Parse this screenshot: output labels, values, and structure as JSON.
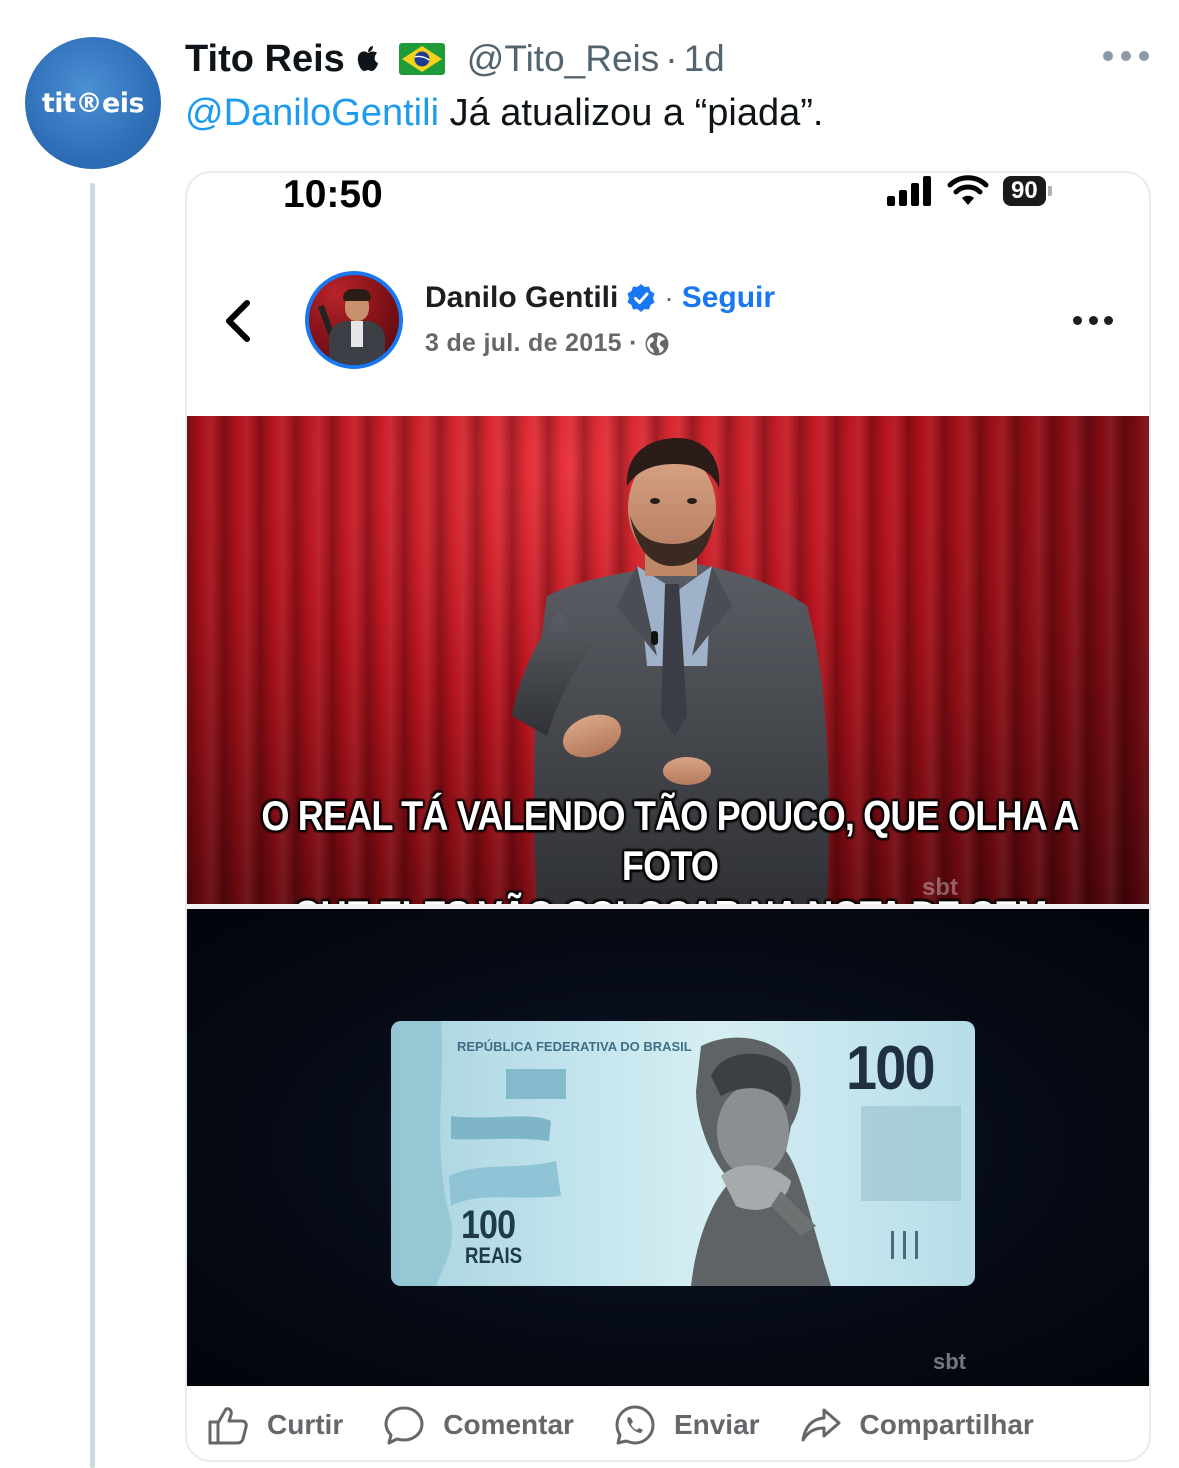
{
  "tweet": {
    "author_name": "Tito Reis",
    "avatar_text": "tit®eis",
    "handle": "@Tito_Reis",
    "separator": "·",
    "time": "1d",
    "mention": "@DaniloGentili",
    "text": " Já atualizou a “piada”."
  },
  "screenshot": {
    "status_time": "10:50",
    "battery": "90"
  },
  "facebook_post": {
    "author_name": "Danilo Gentili",
    "dot": "·",
    "follow_label": "Seguir",
    "date": "3 de jul. de 2015 ·"
  },
  "meme": {
    "caption_line1": "O REAL TÁ VALENDO TÃO POUCO, QUE OLHA A FOTO",
    "caption_line2": "QUE ELES VÃO COLOCAR NA NOTA DE CEM AGORA:",
    "watermark": "sbt",
    "note_title": "REPÚBLICA FEDERATIVA DO BRASIL",
    "note_value_top": "100",
    "note_value_bottom": "100",
    "note_currency": "REAIS"
  },
  "actions": [
    {
      "label": "Curtir",
      "icon": "thumbs-up-icon"
    },
    {
      "label": "Comentar",
      "icon": "comment-icon"
    },
    {
      "label": "Enviar",
      "icon": "whatsapp-icon"
    },
    {
      "label": "Compartilhar",
      "icon": "share-icon"
    }
  ],
  "colors": {
    "link_blue": "#1d9bf0",
    "facebook_blue": "#1877f2",
    "muted_gray": "#536471"
  }
}
